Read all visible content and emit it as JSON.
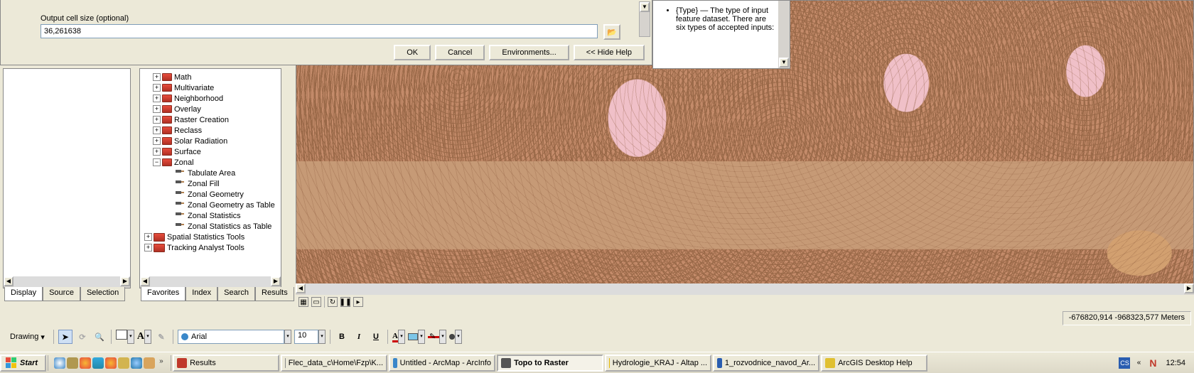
{
  "dialog": {
    "field_label": "Output cell size (optional)",
    "cell_size_value": "36,261638",
    "ok": "OK",
    "cancel": "Cancel",
    "environments": "Environments...",
    "hide_help": "<< Hide Help"
  },
  "help": {
    "bullet_lead": "{Type} — The type of input feature dataset. There are six types of accepted inputs:"
  },
  "toc_tabs": {
    "display": "Display",
    "source": "Source",
    "selection": "Selection"
  },
  "catalog_tabs": {
    "favorites": "Favorites",
    "index": "Index",
    "search": "Search",
    "results": "Results"
  },
  "tree": {
    "toolsets": [
      "Math",
      "Multivariate",
      "Neighborhood",
      "Overlay",
      "Raster Creation",
      "Reclass",
      "Solar Radiation",
      "Surface"
    ],
    "zonal": "Zonal",
    "zonal_tools": [
      "Tabulate Area",
      "Zonal Fill",
      "Zonal Geometry",
      "Zonal Geometry as Table",
      "Zonal Statistics",
      "Zonal Statistics as Table"
    ],
    "bottom_toolboxes": [
      "Spatial Statistics Tools",
      "Tracking Analyst Tools"
    ]
  },
  "drawbar": {
    "label": "Drawing",
    "font": "Arial",
    "size": "10",
    "bold": "B",
    "italic": "I",
    "underline": "U"
  },
  "status": {
    "coords": "-676820,914 -968323,577 Meters"
  },
  "taskbar": {
    "start": "Start",
    "items": [
      {
        "label": "Results",
        "active": false,
        "icon": "#c0392b"
      },
      {
        "label": "Flec_data_c\\Home\\Fzp\\K...",
        "active": false,
        "icon": "#888"
      },
      {
        "label": "Untitled - ArcMap - ArcInfo",
        "active": false,
        "icon": "#3a87c9"
      },
      {
        "label": "Topo to Raster",
        "active": true,
        "icon": "#555",
        "bold": true
      },
      {
        "label": "Hydrologie_KRAJ - Altap ...",
        "active": false,
        "icon": "#e6b800"
      },
      {
        "label": "1_rozvodnice_navod_Ar...",
        "active": false,
        "icon": "#2a5db0"
      },
      {
        "label": "ArcGIS Desktop Help",
        "active": false,
        "icon": "#e0c030"
      }
    ],
    "lang": "CS",
    "clock": "12:54"
  }
}
